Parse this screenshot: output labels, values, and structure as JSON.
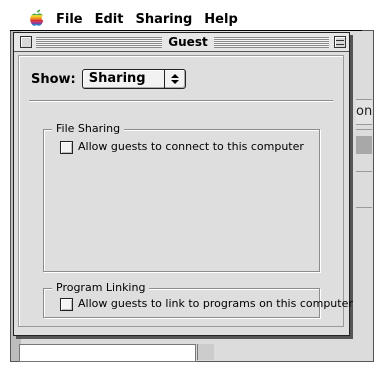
{
  "menubar": {
    "items": [
      "File",
      "Edit",
      "Sharing",
      "Help"
    ]
  },
  "background_window": {
    "partial_column_header": "on"
  },
  "dialog": {
    "title": "Guest",
    "show_label": "Show:",
    "show_popup": {
      "selected": "Sharing"
    },
    "file_sharing": {
      "title": "File Sharing",
      "checkbox_label": "Allow guests to connect to this computer",
      "checked": false
    },
    "program_linking": {
      "title": "Program Linking",
      "checkbox_label": "Allow guests to link to programs on this computer",
      "checked": false
    }
  },
  "colors": {
    "window_bg": "#dedede",
    "menubar_bg": "#ffffff"
  }
}
